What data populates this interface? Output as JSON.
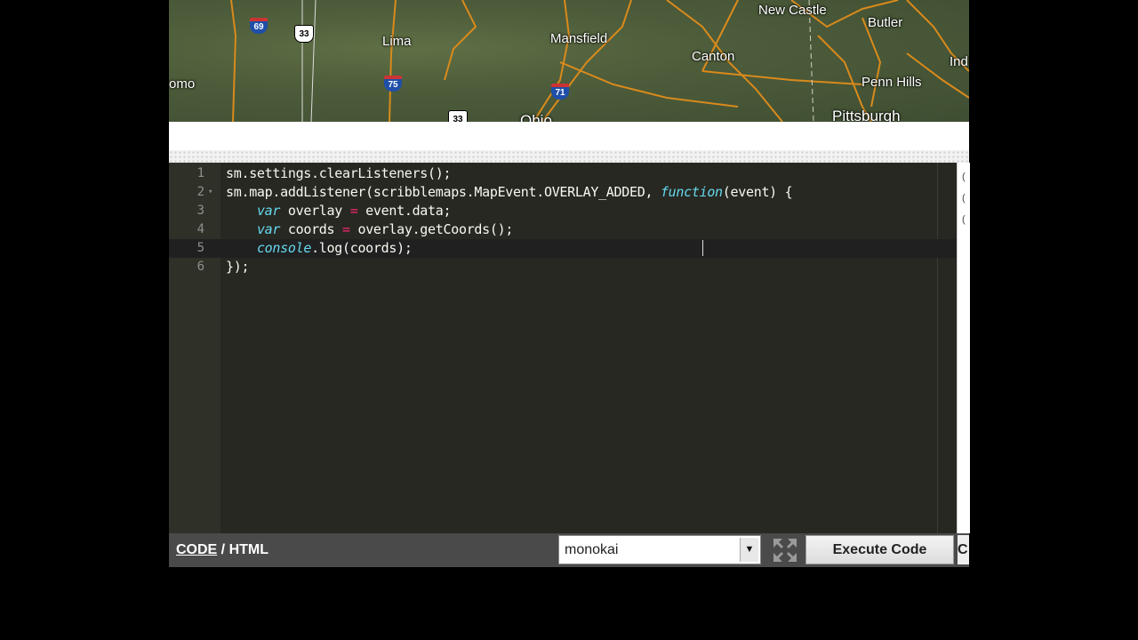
{
  "map": {
    "cities": [
      "Lima",
      "Mansfield",
      "Canton",
      "New Castle",
      "Butler",
      "Penn Hills",
      "Pittsburgh",
      "omo",
      "Ind",
      "Ohio"
    ],
    "shields": [
      "69",
      "33",
      "75",
      "71",
      "33"
    ]
  },
  "editor": {
    "lines": [
      {
        "num": "1",
        "fold": ""
      },
      {
        "num": "2",
        "fold": "▾"
      },
      {
        "num": "3",
        "fold": ""
      },
      {
        "num": "4",
        "fold": ""
      },
      {
        "num": "5",
        "fold": ""
      },
      {
        "num": "6",
        "fold": ""
      }
    ],
    "code": {
      "l1": "sm.settings.clearListeners();",
      "l2a": "sm.map.addListener(scribblemaps.MapEvent.OVERLAY_ADDED, ",
      "l2b": "function",
      "l2c": "(event) {",
      "l3a": "    ",
      "l3b": "var",
      "l3c": " overlay ",
      "l3d": "=",
      "l3e": " event.data;",
      "l4a": "    ",
      "l4b": "var",
      "l4c": " coords ",
      "l4d": "=",
      "l4e": " overlay.getCoords();",
      "l5a": "    ",
      "l5b": "console",
      "l5c": ".log(coords);",
      "l6": "});"
    },
    "theme": {
      "bg": "#272822",
      "keyword": "#66d9ef",
      "operator": "#f92672",
      "text": "#f8f8f2"
    },
    "scroll_marks": [
      "(",
      "(",
      "("
    ]
  },
  "toolbar": {
    "code_label": "CODE",
    "separator": " / ",
    "html_label": "HTML",
    "theme_value": "monokai",
    "execute_label": "Execute Code",
    "cut_label": "C"
  }
}
